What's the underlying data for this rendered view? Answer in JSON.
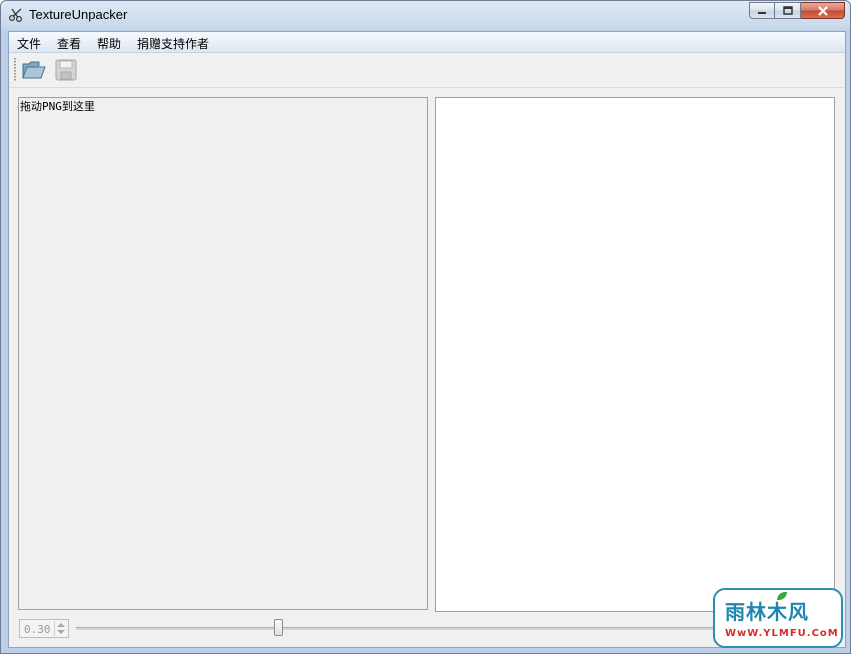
{
  "window": {
    "title": "TextureUnpacker",
    "buttons": {
      "minimize": "minimize-icon",
      "maximize": "maximize-icon",
      "close": "close-icon"
    }
  },
  "menu": {
    "items": [
      {
        "label": "文件"
      },
      {
        "label": "查看"
      },
      {
        "label": "帮助"
      },
      {
        "label": "捐赠支持作者"
      }
    ]
  },
  "toolbar": {
    "open_icon": "folder-open-icon",
    "save_icon": "floppy-save-icon"
  },
  "left_panel": {
    "drop_hint": "拖动PNG到这里"
  },
  "bottom": {
    "scale_value": "0.30",
    "slider_position": 0.31
  },
  "watermark": {
    "main": "雨林木风",
    "site": "WwW.YLMFU.CoM"
  },
  "colors": {
    "title_bar": "#c7d7ea",
    "client_bg": "#f0f0f0",
    "close_button": "#c34a34",
    "watermark_blue": "#1f86b0",
    "watermark_red": "#d62b2b"
  }
}
